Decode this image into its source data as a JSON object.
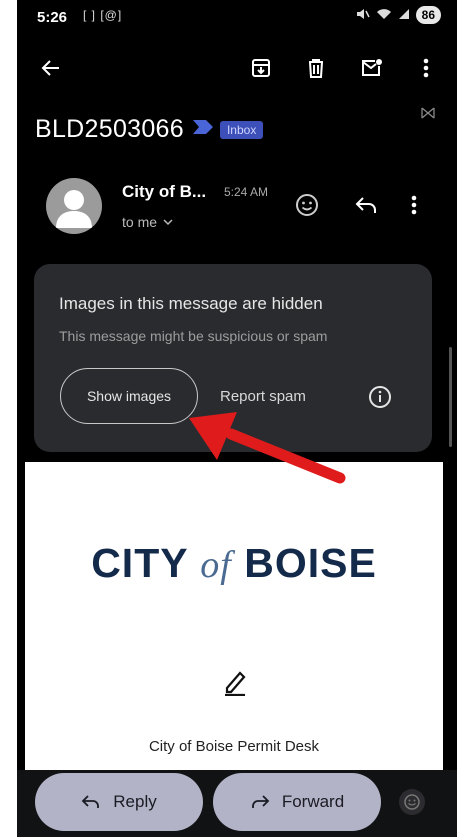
{
  "status_bar": {
    "time": "5:26",
    "notification_icons": "[ ] [@]",
    "battery": "86"
  },
  "toolbar": {
    "back_icon": "arrow-left-icon",
    "archive_icon": "archive-icon",
    "delete_icon": "trash-icon",
    "mark_unread_icon": "mail-unread-icon",
    "more_icon": "more-vert-icon"
  },
  "email": {
    "subject": "BLD2503066",
    "label": "Inbox",
    "sender_name": "City of B...",
    "time": "5:24 AM",
    "recipient": "to me"
  },
  "warning": {
    "title": "Images in this message are hidden",
    "subtitle": "This message might be suspicious or spam",
    "show_images": "Show images",
    "report_spam": "Report spam"
  },
  "body": {
    "logo_city": "CITY",
    "logo_of": "of",
    "logo_boise": "BOISE",
    "permit_desk": "City of Boise Permit Desk"
  },
  "bottom_bar": {
    "reply_label": "Reply",
    "forward_label": "Forward"
  },
  "colors": {
    "background": "#000000",
    "card": "#2a2b2f",
    "inbox_chip": "#3d4fb8",
    "button_fill": "#b3b3c8",
    "annotation_arrow": "#e01b1b",
    "logo_navy": "#142a4a"
  }
}
